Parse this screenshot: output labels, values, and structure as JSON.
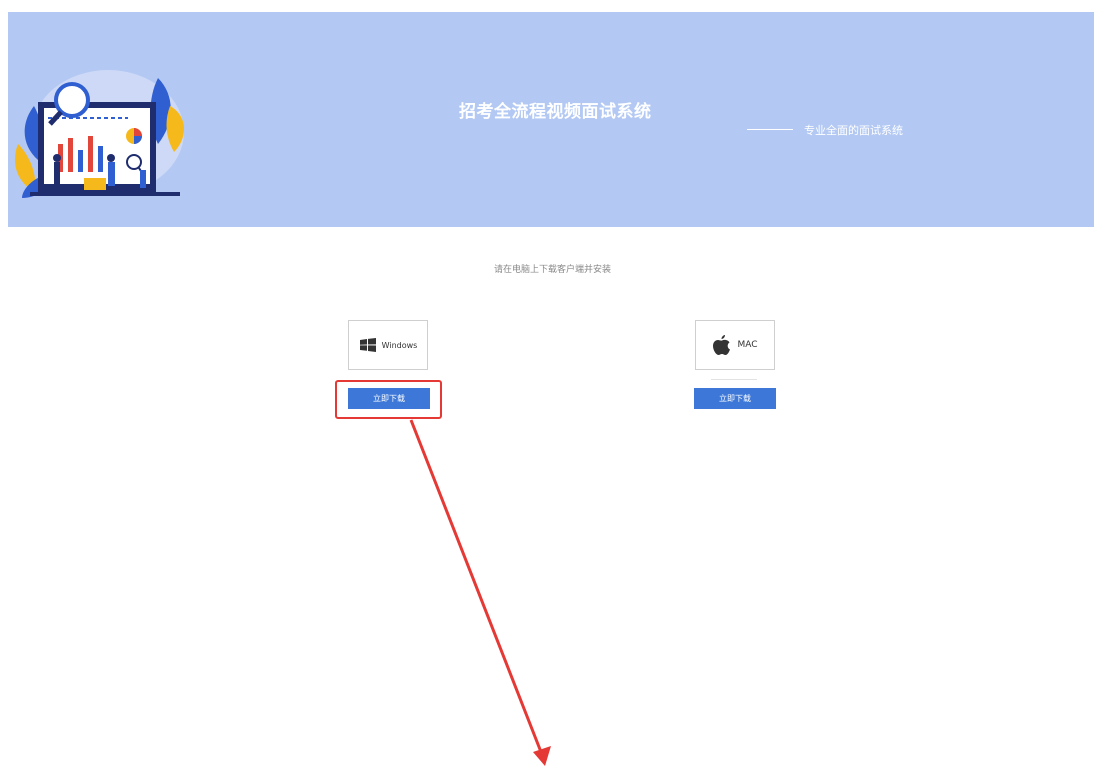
{
  "banner": {
    "title": "招考全流程视频面试系统",
    "subtitle": "专业全面的面试系统",
    "background_color": "#b3c9f3",
    "illustration_icon": "data-analytics-illustration"
  },
  "instruction": "请在电脑上下载客户端并安装",
  "downloads": {
    "windows": {
      "label": "Windows",
      "icon": "windows-logo-icon",
      "button_label": "立即下载"
    },
    "mac": {
      "label": "MAC",
      "icon": "apple-logo-icon",
      "button_label": "立即下载"
    }
  },
  "colors": {
    "button": "#3d78d8",
    "annotation": "#e53935"
  }
}
